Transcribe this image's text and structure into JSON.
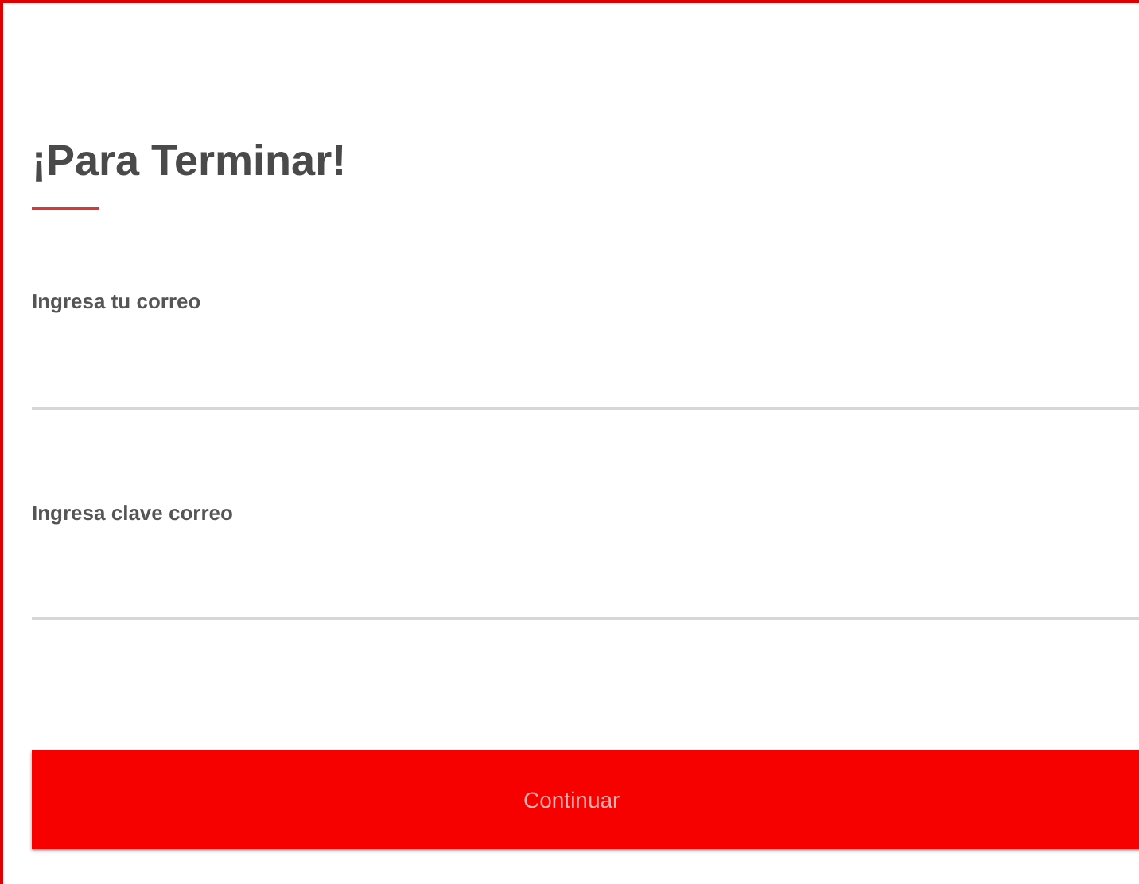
{
  "title": "¡Para Terminar!",
  "fields": [
    {
      "label": "Ingresa tu correo"
    },
    {
      "label": "Ingresa clave correo"
    }
  ],
  "button": "Continuar"
}
